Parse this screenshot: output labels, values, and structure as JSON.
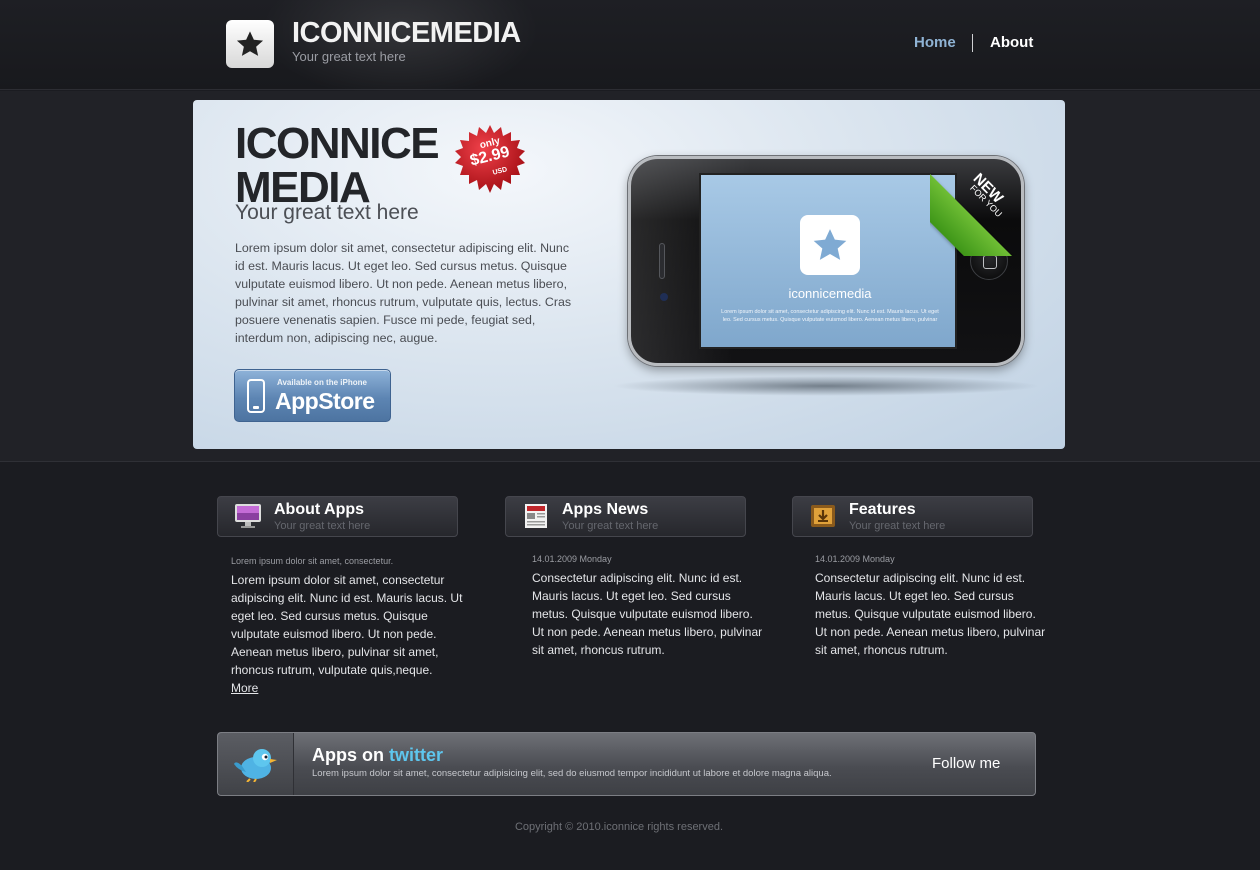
{
  "header": {
    "logo_title": "ICONNICEMEDIA",
    "logo_subtitle": "Your great text here",
    "nav": [
      {
        "label": "Home",
        "active": true,
        "color": "#8fb3d4"
      },
      {
        "label": "About",
        "active": false,
        "color": "#ffffff"
      }
    ]
  },
  "hero": {
    "title_line1": "ICONNICE",
    "title_line2": "MEDIA",
    "subtitle": "Your great text here",
    "body": "Lorem ipsum dolor sit amet, consectetur adipiscing elit. Nunc id est. Mauris lacus. Ut eget leo. Sed cursus metus. Quisque vulputate euismod libero. Ut non pede. Aenean metus libero, pulvinar sit amet, rhoncus rutrum, vulputate quis, lectus. Cras posuere venenatis sapien. Fusce mi pede, feugiat sed, interdum non, adipiscing nec, augue.",
    "price_badge": {
      "prefix": "only",
      "price": "$2.99",
      "currency": "USD",
      "color": "#d3131b"
    },
    "appstore": {
      "small_label": "Available on the iPhone",
      "big_label": "AppStore"
    },
    "phone_screen": {
      "app_name": "iconnicemedia",
      "text": "Lorem ipsum dolor sit amet, consectetur adipiscing elit. Nunc id est. Mauris lacus. Ut eget leo. Sed cursus metus. Quisque vulputate euismod libero. Aenean metus libero, pulvinar"
    },
    "ribbon": {
      "line1": "NEW",
      "line2": "FOR YOU",
      "color": "#4da022"
    }
  },
  "columns": [
    {
      "icon": "monitor-icon",
      "title": "About Apps",
      "subtitle": "Your great text here",
      "meta": "Lorem ipsum dolor sit amet, consectetur.",
      "text": "Lorem ipsum dolor sit amet, consectetur adipiscing elit. Nunc id est. Mauris lacus. Ut eget leo. Sed cursus metus. Quisque vulputate euismod libero. Ut non pede. Aenean metus libero, pulvinar sit amet, rhoncus rutrum, vulputate quis,neque.",
      "more": "More"
    },
    {
      "icon": "newspaper-icon",
      "title": "Apps News",
      "subtitle": "Your great text here",
      "meta": "14.01.2009 Monday",
      "text": "Consectetur adipiscing elit. Nunc id est. Mauris lacus. Ut eget leo. Sed cursus metus. Quisque vulputate euismod libero. Ut non pede. Aenean metus libero, pulvinar sit amet, rhoncus rutrum."
    },
    {
      "icon": "download-box-icon",
      "title": "Features",
      "subtitle": "Your great text here",
      "meta": "14.01.2009 Monday",
      "text": "Consectetur adipiscing elit. Nunc id est. Mauris lacus. Ut eget leo. Sed cursus metus. Quisque vulputate euismod libero. Ut non pede. Aenean metus libero, pulvinar sit amet, rhoncus rutrum."
    }
  ],
  "twitter": {
    "icon": "twitter-bird-icon",
    "heading_prefix": "Apps on",
    "heading_brand": "twitter",
    "text": "Lorem ipsum dolor sit amet, consectetur adipisicing elit, sed do eiusmod tempor incididunt ut labore et dolore magna aliqua.",
    "follow_label": "Follow me",
    "brand_color": "#5ec6ee"
  },
  "footer": {
    "copyright": "Copyright © 2010.iconnice rights reserved."
  }
}
